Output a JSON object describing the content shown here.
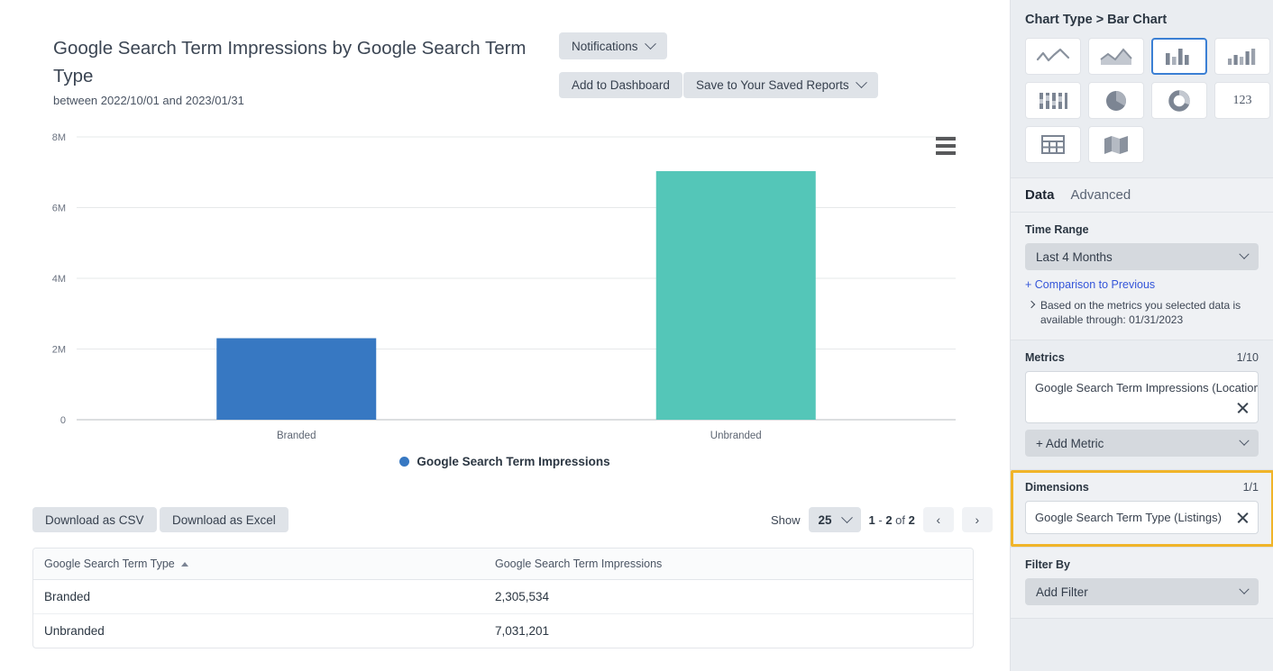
{
  "report": {
    "title": "Google Search Term Impressions by Google Search Term Type",
    "subtitle": "between 2022/10/01 and 2023/01/31",
    "notifications_label": "Notifications",
    "add_to_dashboard_label": "Add to Dashboard",
    "save_to_saved_reports_label": "Save to Your Saved Reports"
  },
  "chart_data": {
    "type": "bar",
    "title": "Google Search Term Impressions by Google Search Term Type",
    "subtitle": "between 2022/10/01 and 2023/01/31",
    "categories": [
      "Branded",
      "Unbranded"
    ],
    "values": [
      2305534,
      7031201
    ],
    "colors": [
      "#3778c2",
      "#54c6b8"
    ],
    "series": [
      {
        "name": "Google Search Term Impressions",
        "values": [
          2305534,
          7031201
        ]
      }
    ],
    "xlabel": "",
    "ylabel": "",
    "ylim": [
      0,
      8000000
    ],
    "yticks": [
      0,
      2000000,
      4000000,
      6000000,
      8000000
    ],
    "ytick_labels": [
      "0",
      "2M",
      "4M",
      "6M",
      "8M"
    ],
    "grid": true,
    "legend": {
      "position": "bottom",
      "entries": [
        "Google Search Term Impressions"
      ],
      "marker_color": "#3778c2"
    },
    "menu_icon": "hamburger-menu-icon"
  },
  "table_controls": {
    "download_csv_label": "Download as CSV",
    "download_excel_label": "Download as Excel",
    "show_label": "Show",
    "page_size": "25",
    "range_from": "1",
    "range_sep": " - ",
    "range_to": "2",
    "of_label": " of ",
    "total": "2",
    "prev_icon": "‹",
    "next_icon": "›"
  },
  "table": {
    "columns": [
      "Google Search Term Type",
      "Google Search Term Impressions"
    ],
    "sorted_column": 0,
    "sort_direction": "asc",
    "rows": [
      {
        "type": "Branded",
        "impressions": "2,305,534"
      },
      {
        "type": "Unbranded",
        "impressions": "7,031,201"
      }
    ]
  },
  "sidebar": {
    "chart_type_heading": "Chart Type > Bar Chart",
    "chart_types": [
      {
        "name": "line-chart-icon",
        "selected": false
      },
      {
        "name": "area-chart-icon",
        "selected": false
      },
      {
        "name": "bar-chart-icon",
        "selected": true
      },
      {
        "name": "column-chart-icon",
        "selected": false
      },
      {
        "name": "stacked-bar-chart-icon",
        "selected": false
      },
      {
        "name": "pie-chart-icon",
        "selected": false
      },
      {
        "name": "donut-chart-icon",
        "selected": false
      },
      {
        "name": "number-chart-icon",
        "selected": false,
        "label": "123"
      },
      {
        "name": "table-chart-icon",
        "selected": false
      },
      {
        "name": "map-chart-icon",
        "selected": false
      }
    ],
    "tabs": [
      {
        "label": "Data",
        "active": true
      },
      {
        "label": "Advanced",
        "active": false
      }
    ],
    "time_range": {
      "label": "Time Range",
      "value": "Last 4 Months",
      "comparison_link": "+ Comparison to Previous",
      "note": "Based on the metrics you selected data is available through: 01/31/2023"
    },
    "metrics": {
      "label": "Metrics",
      "count": "1/10",
      "items": [
        "Google Search Term Impressions (Location Lis..."
      ],
      "add_label": "+ Add Metric"
    },
    "dimensions": {
      "label": "Dimensions",
      "count": "1/1",
      "items": [
        "Google Search Term Type (Listings)"
      ],
      "highlight_color": "#f0b429"
    },
    "filter": {
      "label": "Filter By",
      "value": "Add Filter"
    }
  }
}
